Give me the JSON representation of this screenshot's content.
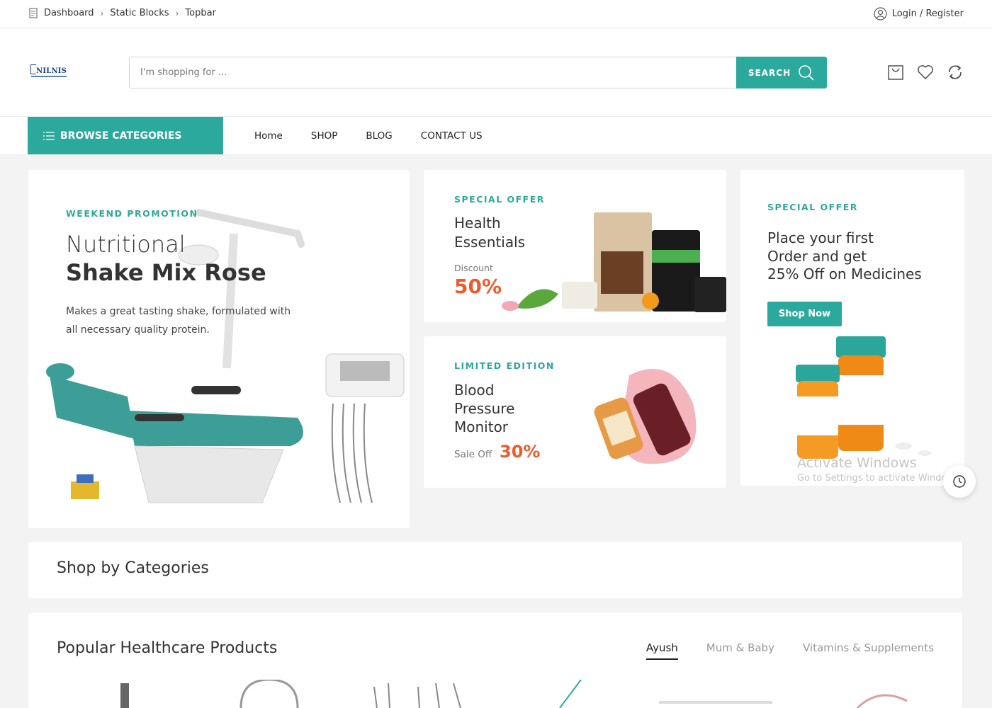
{
  "breadcrumb": {
    "items": [
      "Dashboard",
      "Static Blocks",
      "Topbar"
    ]
  },
  "auth": {
    "login_label": "Login / Register"
  },
  "brand": {
    "logo_text": "NILNIS"
  },
  "search": {
    "placeholder": "I'm shopping for ...",
    "button_label": "SEARCH"
  },
  "nav": {
    "browse_label": "BROWSE CATEGORIES",
    "menu": [
      "Home",
      "SHOP",
      "BLOG",
      "CONTACT US"
    ]
  },
  "hero": {
    "eyebrow": "WEEKEND PROMOTION",
    "title_light": "Nutritional",
    "title_bold": "Shake Mix Rose",
    "description": "Makes a great tasting shake, formulated with all necessary quality protein."
  },
  "promo_health": {
    "eyebrow": "SPECIAL OFFER",
    "title_line1": "Health",
    "title_line2": "Essentials",
    "discount_label": "Discount",
    "discount_value": "50%"
  },
  "promo_bp": {
    "eyebrow": "LIMITED EDITION",
    "title_line1": "Blood",
    "title_line2": "Pressure",
    "title_line3": "Monitor",
    "sale_label": "Sale Off",
    "sale_value": "30%"
  },
  "promo_medicine": {
    "eyebrow": "SPECIAL OFFER",
    "title_line1": "Place your first",
    "title_line2": "Order and get",
    "title_line3": "25% Off on Medicines",
    "button_label": "Shop Now"
  },
  "watermark": {
    "line1": "Activate Windows",
    "line2": "Go to Settings to activate Windows."
  },
  "sections": {
    "categories_title": "Shop by Categories",
    "popular_title": "Popular Healthcare Products",
    "tabs": [
      "Ayush",
      "Mum & Baby",
      "Vitamins & Supplements"
    ],
    "active_tab": "Ayush"
  },
  "colors": {
    "accent": "#2ca99d",
    "highlight": "#ef5a2a",
    "background": "#f3f3f3"
  }
}
